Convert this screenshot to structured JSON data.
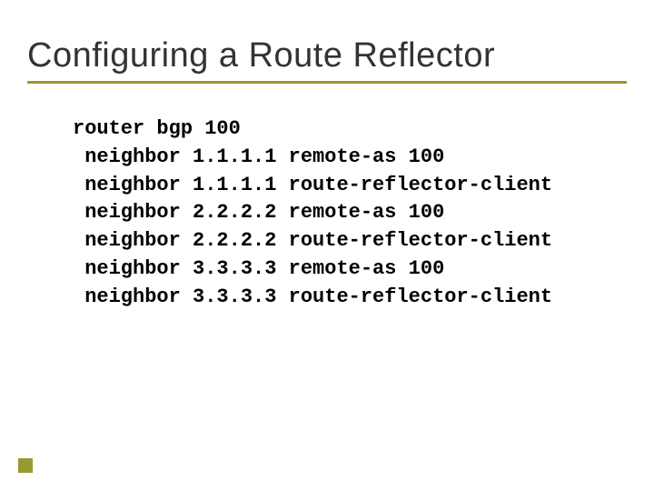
{
  "slide": {
    "title": "Configuring a Route Reflector",
    "code": {
      "line1": "router bgp 100",
      "line2": " neighbor 1.1.1.1 remote-as 100",
      "line3": " neighbor 1.1.1.1 route-reflector-client",
      "line4": " neighbor 2.2.2.2 remote-as 100",
      "line5": " neighbor 2.2.2.2 route-reflector-client",
      "line6": " neighbor 3.3.3.3 remote-as 100",
      "line7": " neighbor 3.3.3.3 route-reflector-client"
    }
  }
}
